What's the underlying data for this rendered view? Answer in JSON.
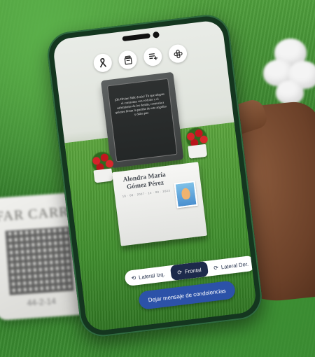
{
  "background": {
    "plaque_text": "FAR CARRA",
    "plaque_date": "44-2-14"
  },
  "toolbar": {
    "icons": [
      "ribbon-icon",
      "urn-icon",
      "list-add-icon",
      "flower-icon"
    ]
  },
  "memorial": {
    "epitaph": "¡Oh Divino Niño Jesús! Tú que alegras el corazones con el dolor y el sufrimiento de los demás, consuela a quienes lloran la partida de este angelito y dales paz",
    "name": "Alondra María Gómez Pérez",
    "dates": "18 · 08 · 2007  ·  14 · 08 · 2023"
  },
  "views": {
    "left": "Lateral Izq.",
    "front": "Frontal",
    "right": "Lateral Der.",
    "active": "front"
  },
  "actions": {
    "condolence_label": "Dejar mensaje de condolencias"
  },
  "colors": {
    "accent": "#2c52a8",
    "active_tab": "#1d2a4b",
    "grass": "#3f8d2d",
    "phone_frame": "#14361f"
  }
}
